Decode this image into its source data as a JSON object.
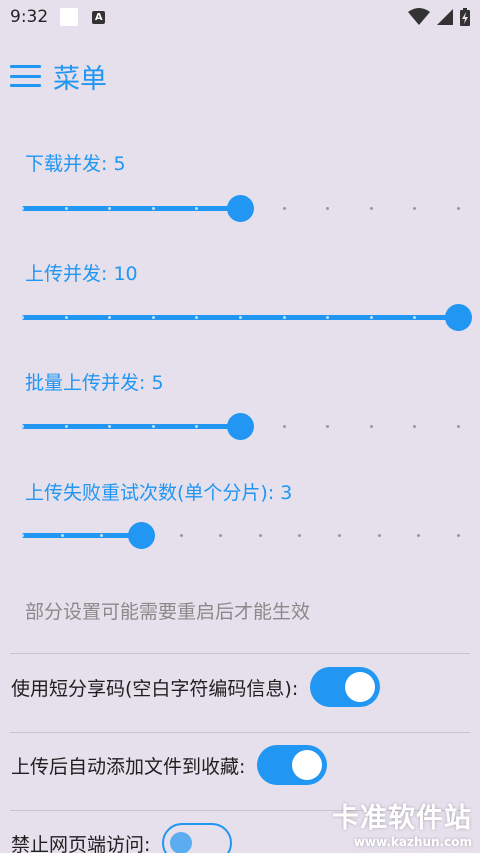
{
  "status_bar": {
    "time": "9:32",
    "icons": [
      "notification-square-icon",
      "a-badge-icon",
      "wifi-icon",
      "signal-icon",
      "battery-icon"
    ]
  },
  "app_bar": {
    "title": "菜单",
    "menu_icon": "hamburger-menu-icon"
  },
  "accent_color": "#2196f3",
  "sliders": [
    {
      "label": "下载并发: 5",
      "value": 5,
      "min": 0,
      "max": 10,
      "ticks": 11
    },
    {
      "label": "上传并发: 10",
      "value": 10,
      "min": 0,
      "max": 10,
      "ticks": 11
    },
    {
      "label": "批量上传并发: 5",
      "value": 5,
      "min": 0,
      "max": 10,
      "ticks": 11
    },
    {
      "label": "上传失败重试次数(单个分片): 3",
      "value": 3,
      "min": 0,
      "max": 11,
      "ticks": 12
    }
  ],
  "note": "部分设置可能需要重启后才能生效",
  "switches": [
    {
      "label": "使用短分享码(空白字符编码信息):",
      "on": true
    },
    {
      "label": "上传后自动添加文件到收藏:",
      "on": true
    },
    {
      "label": "禁止网页端访问:",
      "on": false
    }
  ],
  "watermark": {
    "main": "卡准软件站",
    "url": "www.kazhun.com"
  }
}
